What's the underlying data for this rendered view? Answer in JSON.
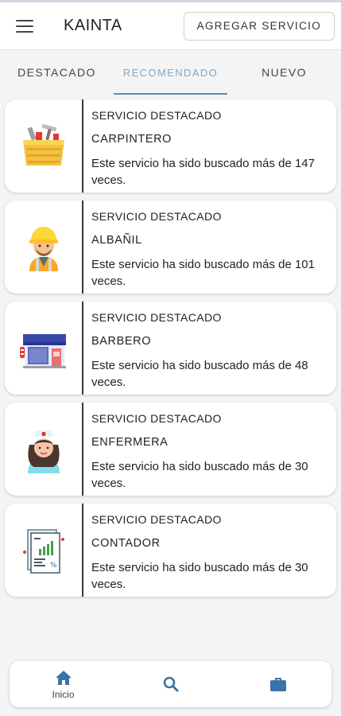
{
  "header": {
    "menu_icon": "hamburger-menu-icon",
    "title": "KAINTA",
    "add_service_label": "AGREGAR SERVICIO"
  },
  "tabs": [
    {
      "label": "DESTACADO",
      "active": false
    },
    {
      "label": "RECOMENDADO",
      "active": true
    },
    {
      "label": "NUEVO",
      "active": false
    }
  ],
  "services": [
    {
      "kicker": "SERVICIO DESTACADO",
      "name": "CARPINTERO",
      "description": "Este servicio ha sido buscado más de 147 veces.",
      "icon": "toolbox-icon"
    },
    {
      "kicker": "SERVICIO DESTACADO",
      "name": "ALBAÑIL",
      "description": "Este servicio ha sido buscado más de 101 veces.",
      "icon": "construction-worker-icon"
    },
    {
      "kicker": "SERVICIO DESTACADO",
      "name": "BARBERO",
      "description": "Este servicio ha sido buscado más de 48 veces.",
      "icon": "barber-shop-icon"
    },
    {
      "kicker": "SERVICIO DESTACADO",
      "name": "ENFERMERA",
      "description": "Este servicio ha sido buscado más de 30 veces.",
      "icon": "nurse-icon"
    },
    {
      "kicker": "SERVICIO DESTACADO",
      "name": "CONTADOR",
      "description": "Este servicio ha sido buscado más de 30 veces.",
      "icon": "accounting-report-icon"
    }
  ],
  "bottom_nav": {
    "home_label": "Inicio",
    "home_icon": "home-icon",
    "search_icon": "search-icon",
    "briefcase_icon": "briefcase-icon"
  },
  "colors": {
    "accent": "#3b73a8",
    "tab_active_text": "#7fa8c8",
    "tab_indicator": "#5b8db8"
  }
}
